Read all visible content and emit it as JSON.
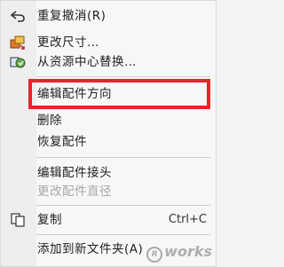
{
  "menu": {
    "items": [
      {
        "label": "重复撤消(R)",
        "icon": "undo-icon",
        "enabled": true
      },
      {
        "label": "更改尺寸…",
        "icon": "resize-icon",
        "enabled": true
      },
      {
        "label": "从资源中心替换…",
        "icon": "replace-icon",
        "enabled": true
      },
      {
        "label": "编辑配件方向",
        "enabled": true
      },
      {
        "label": "删除",
        "enabled": true
      },
      {
        "label": "恢复配件",
        "enabled": true
      },
      {
        "label": "编辑配件接头",
        "enabled": true
      },
      {
        "label": "更改配件直径",
        "enabled": false
      },
      {
        "label": "复制",
        "shortcut": "Ctrl+C",
        "icon": "copy-icon",
        "enabled": true
      },
      {
        "label": "添加到新文件夹(A)",
        "enabled": true
      }
    ],
    "highlight_color": "#e8232a",
    "disabled_color": "#a8a8a8"
  },
  "watermark": {
    "text": "works",
    "mark": "R"
  }
}
